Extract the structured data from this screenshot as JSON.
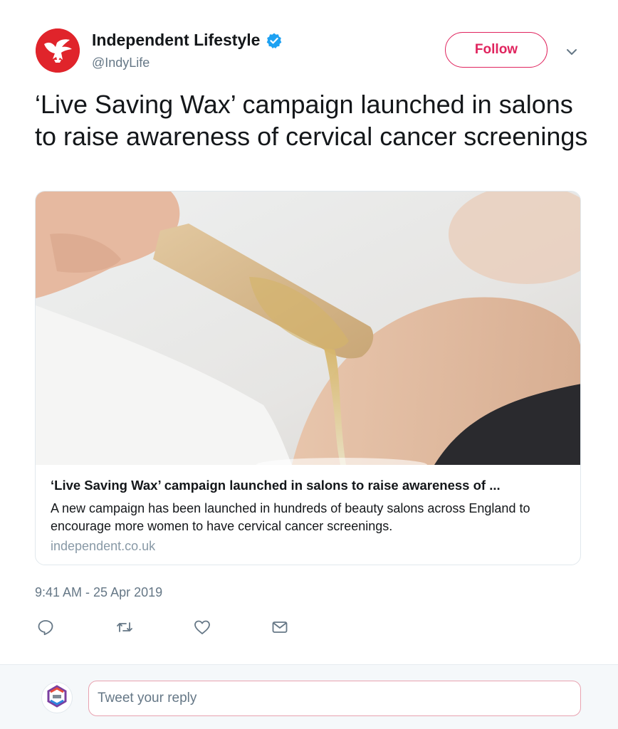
{
  "author": {
    "name": "Independent Lifestyle",
    "handle": "@IndyLife",
    "verified": true,
    "brand_color": "#e0242b"
  },
  "follow_button": {
    "label": "Follow",
    "color": "#e0245e"
  },
  "menu": {
    "icon": "chevron-down-icon"
  },
  "tweet": {
    "text": "‘Live Saving Wax’ campaign launched in salons to raise awareness of cervical cancer screenings"
  },
  "card": {
    "image": "waxing-stick-photo",
    "title": "‘Live Saving Wax’ campaign launched in salons to raise awareness of ...",
    "description": "A new campaign has been launched in hundreds of beauty salons across England to encourage more women to have cervical cancer screenings.",
    "domain": "independent.co.uk"
  },
  "timestamp": "9:41 AM - 25 Apr 2019",
  "actions": [
    {
      "name": "reply",
      "icon": "reply-icon"
    },
    {
      "name": "retweet",
      "icon": "retweet-icon"
    },
    {
      "name": "like",
      "icon": "heart-icon"
    },
    {
      "name": "direct-message",
      "icon": "envelope-icon"
    }
  ],
  "reply": {
    "placeholder": "Tweet your reply"
  }
}
